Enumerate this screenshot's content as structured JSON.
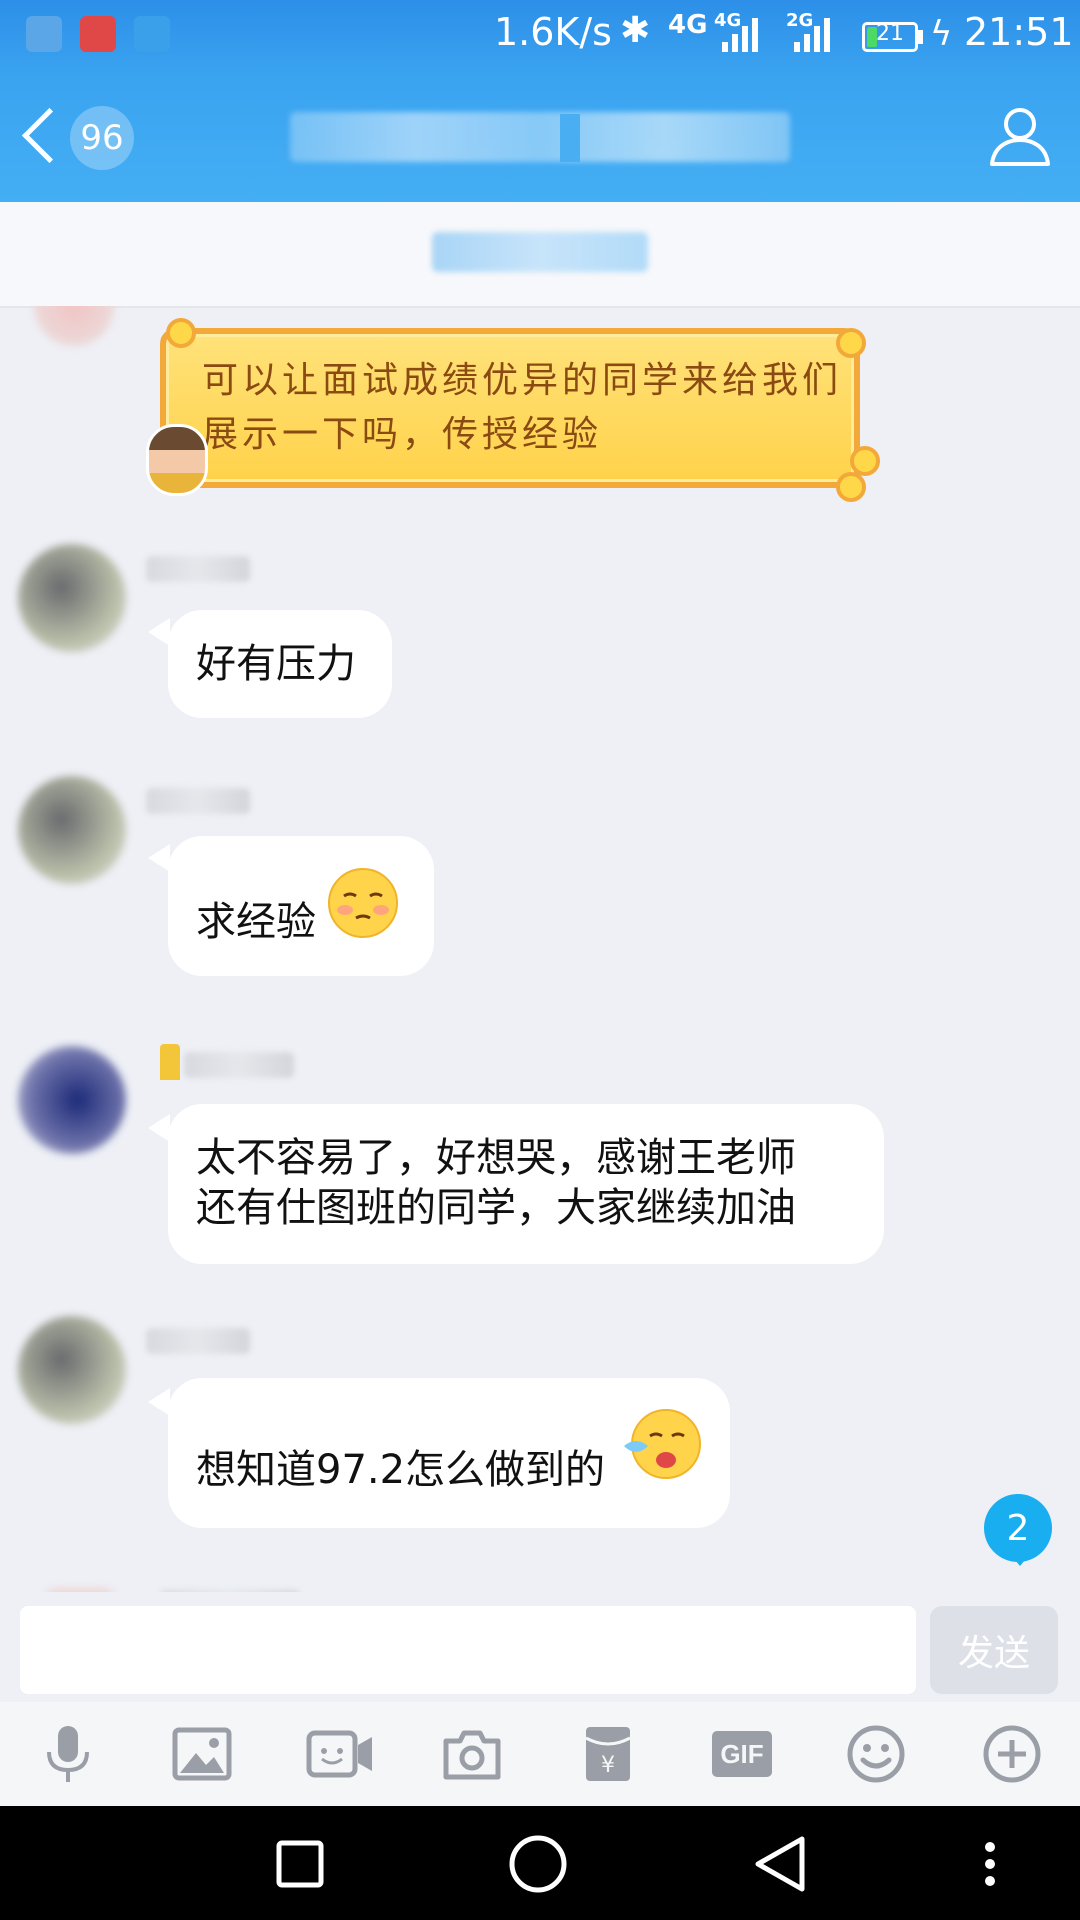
{
  "status_bar": {
    "net_speed": "1.6K/s",
    "network_1": "4G",
    "network_2": "4G",
    "network_3": "2G",
    "battery_level": "21",
    "battery_fraction": 0.21,
    "time": "21:51"
  },
  "header": {
    "unread_count": "96"
  },
  "messages": [
    {
      "type": "gift-bubble",
      "text": "可以让面试成绩优异的同学来给我们展示一下吗，传授经验"
    },
    {
      "type": "text",
      "text": "好有压力"
    },
    {
      "type": "text",
      "text": "求经验",
      "emoji": "shy-face"
    },
    {
      "type": "text",
      "line1": "太不容易了，好想哭，感谢王老师",
      "line2": "还有仕图班的同学，大家继续加油"
    },
    {
      "type": "text",
      "text": "想知道97.2怎么做到的",
      "emoji": "crying-face"
    }
  ],
  "new_message_badge": "2",
  "composer": {
    "input_value": "",
    "send_label": "发送"
  },
  "toolbar": {
    "gif_label": "GIF",
    "tools": [
      "microphone-icon",
      "image-icon",
      "video-call-icon",
      "camera-icon",
      "red-packet-icon",
      "gif-icon",
      "emoji-icon",
      "plus-icon"
    ]
  },
  "nav": [
    "recent-apps-icon",
    "home-icon",
    "back-icon",
    "menu-icon"
  ],
  "colors": {
    "header_blue": "#3aa3f0",
    "badge_blue": "#19aef0",
    "battery_green": "#4cd964"
  }
}
